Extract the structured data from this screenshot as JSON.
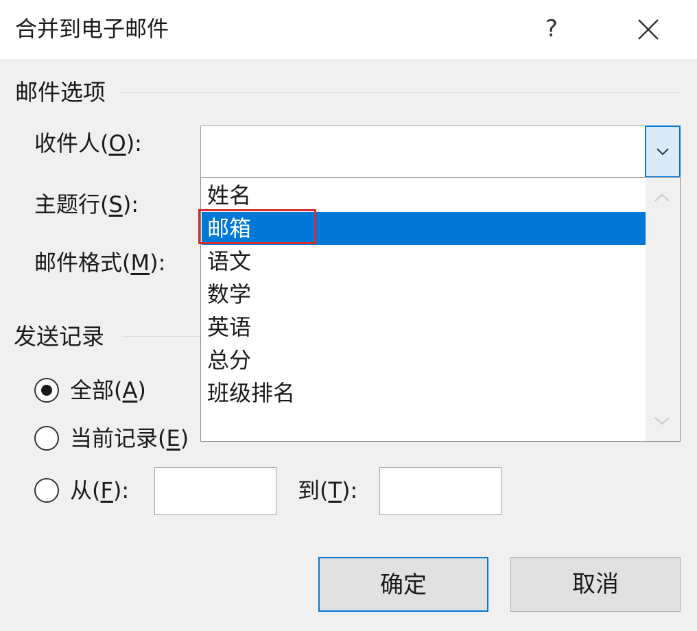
{
  "dialog": {
    "title": "合并到电子邮件",
    "help_label": "?"
  },
  "mail_options": {
    "group_label": "邮件选项",
    "to_label_pre": "收件人(",
    "to_label_key": "O",
    "to_label_post": "):",
    "to_value": "",
    "subject_label_pre": "主题行(",
    "subject_label_key": "S",
    "subject_label_post": "):",
    "format_label_pre": "邮件格式(",
    "format_label_key": "M",
    "format_label_post": "):"
  },
  "dropdown": {
    "items": [
      "姓名",
      "邮箱",
      "语文",
      "数学",
      "英语",
      "总分",
      "班级排名"
    ],
    "selected_index": 1,
    "highlight_color": "#d32f2f"
  },
  "send_records": {
    "group_label": "发送记录",
    "all_pre": "全部(",
    "all_key": "A",
    "all_post": ")",
    "current_pre": "当前记录(",
    "current_key": "E",
    "current_post": ")",
    "from_pre": "从(",
    "from_key": "F",
    "from_post": "):",
    "to_pre": "到(",
    "to_key": "T",
    "to_post": "):",
    "from_value": "",
    "to_value": ""
  },
  "buttons": {
    "ok": "确定",
    "cancel": "取消"
  },
  "colors": {
    "accent": "#0078d7",
    "selection_text": "#ffffff"
  }
}
